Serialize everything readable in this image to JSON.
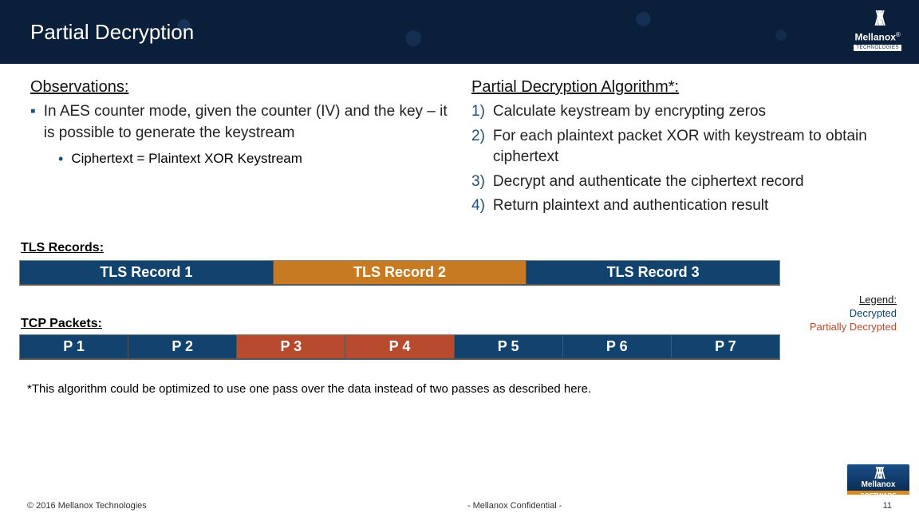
{
  "header": {
    "title": "Partial Decryption",
    "brand": "Mellanox",
    "tech": "TECHNOLOGIES"
  },
  "left": {
    "heading": "Observations:",
    "bullet": "In AES counter mode, given the counter (IV) and the key – it is possible to generate the keystream",
    "sub": "Ciphertext = Plaintext XOR Keystream"
  },
  "right": {
    "heading": "Partial Decryption Algorithm*:",
    "items": [
      "Calculate keystream by encrypting zeros",
      "For each plaintext packet XOR with keystream to obtain ciphertext",
      "Decrypt and authenticate the ciphertext record",
      "Return plaintext and authentication result"
    ]
  },
  "tls": {
    "heading": "TLS Records:",
    "records": [
      "TLS Record 1",
      "TLS Record 2",
      "TLS Record 3"
    ]
  },
  "tcp": {
    "heading": "TCP Packets:",
    "packets": [
      "P 1",
      "P 2",
      "P 3",
      "P 4",
      "P 5",
      "P 6",
      "P 7"
    ]
  },
  "legend": {
    "title": "Legend:",
    "l1": "Decrypted",
    "l2": "Partially Decrypted"
  },
  "footnote": "*This algorithm could be optimized to use one pass over the data instead of two passes as described here.",
  "footer": {
    "copyright": "© 2016 Mellanox Technologies",
    "confidential": "- Mellanox Confidential -",
    "page": "11"
  },
  "corner": {
    "brand": "Mellanox",
    "soft": "SOFTWARE"
  }
}
